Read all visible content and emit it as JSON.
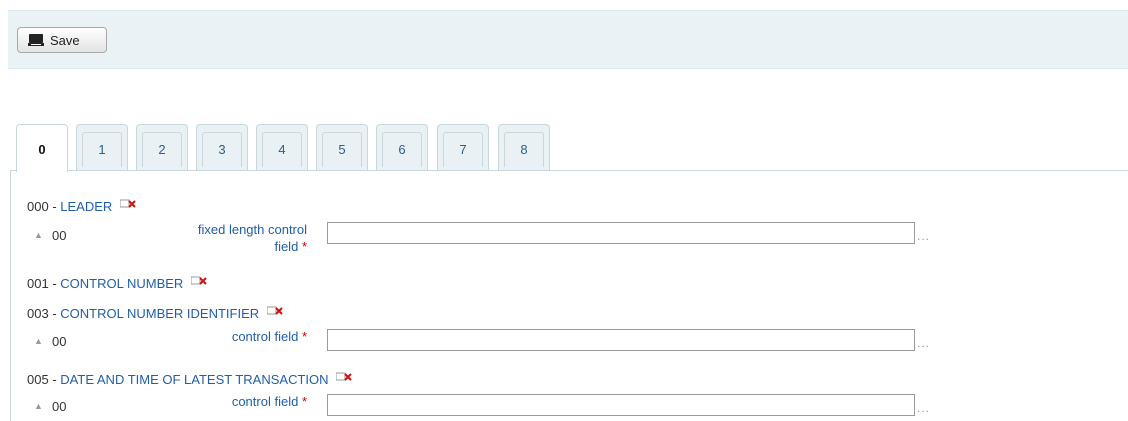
{
  "toolbar": {
    "save_label": "Save",
    "save_icon": "save-icon"
  },
  "tabs": [
    "0",
    "1",
    "2",
    "3",
    "4",
    "5",
    "6",
    "7",
    "8"
  ],
  "active_tab": "0",
  "fields": [
    {
      "tag": "000",
      "name": "LEADER",
      "subfields": [
        {
          "code": "00",
          "label": "fixed length control field",
          "label_line1": "fixed length control",
          "label_line2": "field",
          "required": "*",
          "value": "",
          "more": "..."
        }
      ]
    },
    {
      "tag": "001",
      "name": "CONTROL NUMBER",
      "subfields": []
    },
    {
      "tag": "003",
      "name": "CONTROL NUMBER IDENTIFIER",
      "subfields": [
        {
          "code": "00",
          "label": "control field",
          "required": "*",
          "value": "",
          "more": "..."
        }
      ]
    },
    {
      "tag": "005",
      "name": "DATE AND TIME OF LATEST TRANSACTION",
      "subfields": [
        {
          "code": "00",
          "label": "control field",
          "required": "*",
          "value": "",
          "more": "..."
        }
      ]
    }
  ],
  "colors": {
    "toolbar_bg": "#eaf2f5",
    "link": "#1f5ea8",
    "required": "#cc0000",
    "delete_icon": "#d01010"
  }
}
